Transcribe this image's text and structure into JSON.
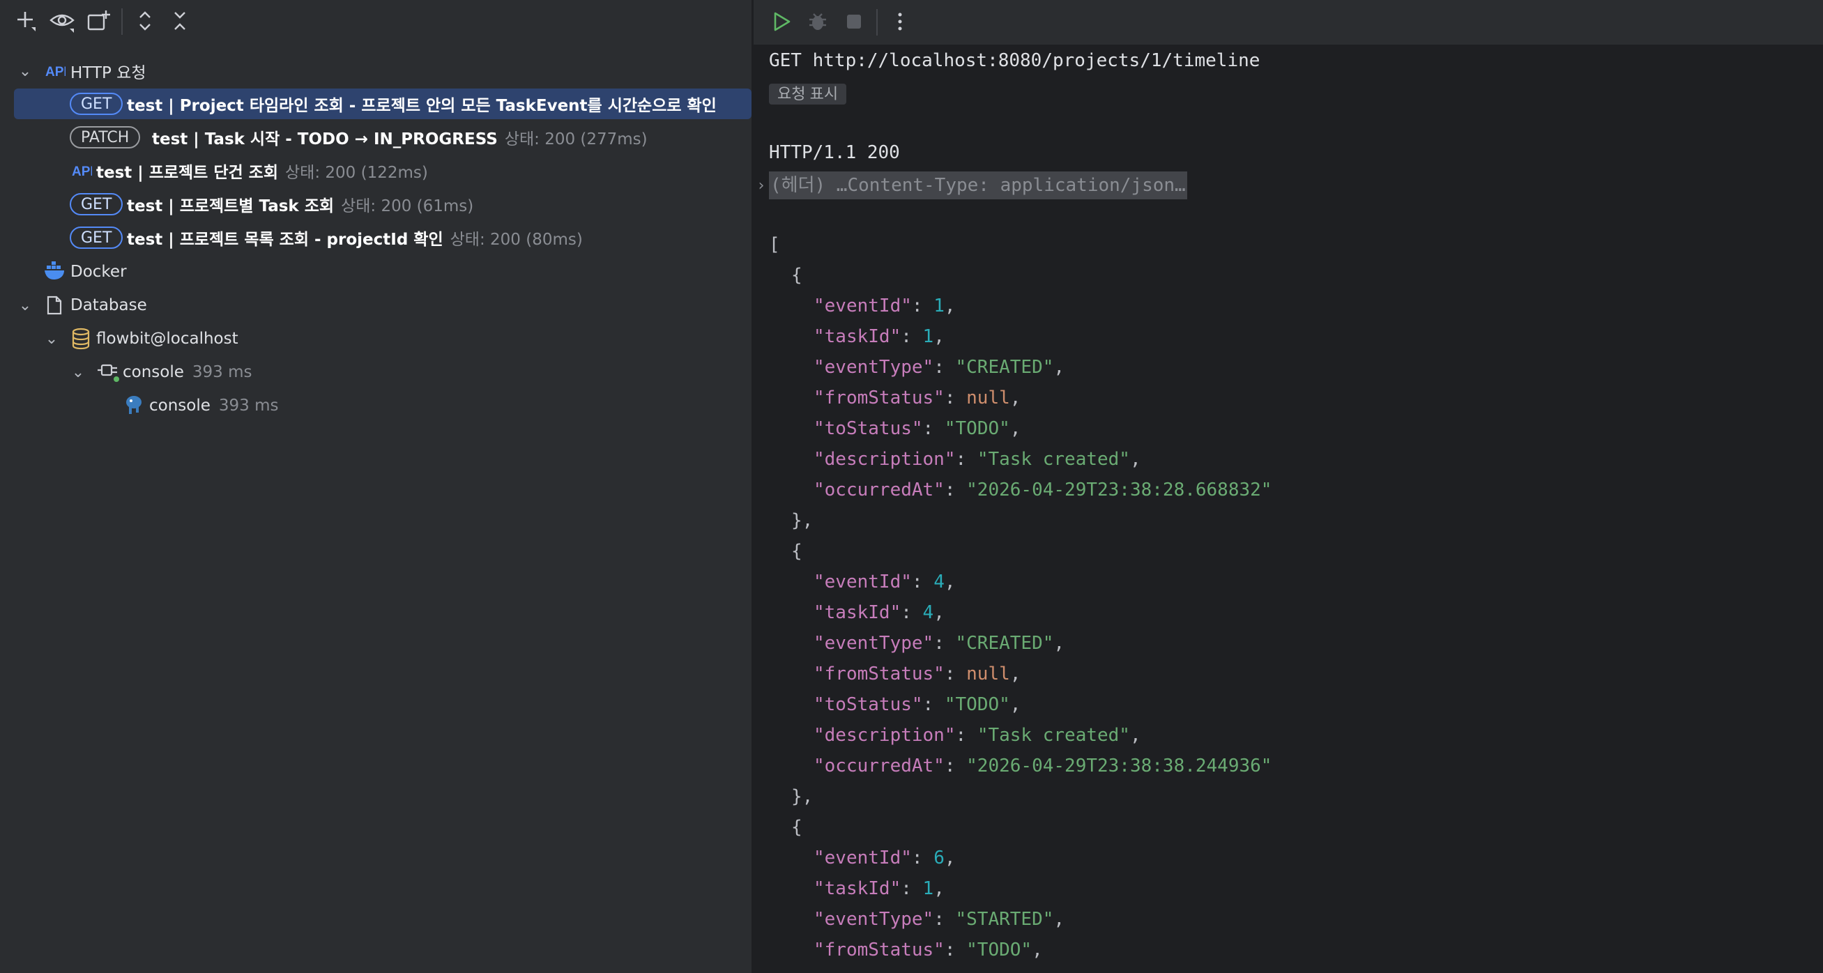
{
  "left_panel": {
    "toolbar_icons": [
      "add-icon",
      "eye-icon",
      "new-group-icon",
      "expand-all-icon",
      "collapse-all-icon"
    ],
    "tree": {
      "http_group_label": "HTTP 요청",
      "requests": [
        {
          "method": "GET",
          "title": "test  |  Project 타임라인 조회 - 프로젝트 안의 모든 TaskEvent를 시간순으로 확인",
          "status": ""
        },
        {
          "method": "PATCH",
          "title": "test  |  Task 시작 - TODO → IN_PROGRESS",
          "status": "상태: 200 (277ms)"
        },
        {
          "method": "",
          "title": "test | 프로젝트 단건 조회",
          "status": "상태: 200 (122ms)"
        },
        {
          "method": "GET",
          "title": "test  |  프로젝트별 Task 조회",
          "status": "상태: 200 (61ms)"
        },
        {
          "method": "GET",
          "title": "test  |  프로젝트 목록 조회 - projectId 확인",
          "status": "상태: 200 (80ms)"
        }
      ],
      "docker_label": "Docker",
      "database_label": "Database",
      "datasource_label": "flowbit@localhost",
      "session_label": "console",
      "session_time": "393 ms",
      "console_label": "console",
      "console_time": "393 ms"
    }
  },
  "right_panel": {
    "toolbar_icons": [
      "run-icon",
      "debug-icon",
      "stop-icon",
      "more-icon"
    ],
    "request_line": "GET http://localhost:8080/projects/1/timeline",
    "show_request_label": "요청 표시",
    "status_line": "HTTP/1.1 200",
    "headers_summary": "(헤더) …Content-Type: application/json…",
    "json_open": "[",
    "events": [
      {
        "eventId": "1",
        "taskId": "1",
        "eventType": "\"CREATED\"",
        "fromStatus": "null",
        "toStatus": "\"TODO\"",
        "description": "\"Task created\"",
        "occurredAt": "\"2026-04-29T23:38:28.668832\""
      },
      {
        "eventId": "4",
        "taskId": "4",
        "eventType": "\"CREATED\"",
        "fromStatus": "null",
        "toStatus": "\"TODO\"",
        "description": "\"Task created\"",
        "occurredAt": "\"2026-04-29T23:38:38.244936\""
      },
      {
        "eventId": "6",
        "taskId": "1",
        "eventType": "\"STARTED\"",
        "fromStatus": "\"TODO\""
      }
    ],
    "keys": {
      "eventId": "\"eventId\"",
      "taskId": "\"taskId\"",
      "eventType": "\"eventType\"",
      "fromStatus": "\"fromStatus\"",
      "toStatus": "\"toStatus\"",
      "description": "\"description\"",
      "occurredAt": "\"occurredAt\""
    }
  },
  "colors": {
    "left_bg": "#2b2d30",
    "editor_bg": "#1e1f22",
    "selection": "#2e436e",
    "method_badge": "#548af7",
    "json_key": "#c77dbb",
    "json_string": "#6aab73",
    "json_number": "#2aacb8",
    "json_null": "#cf8e6d"
  }
}
